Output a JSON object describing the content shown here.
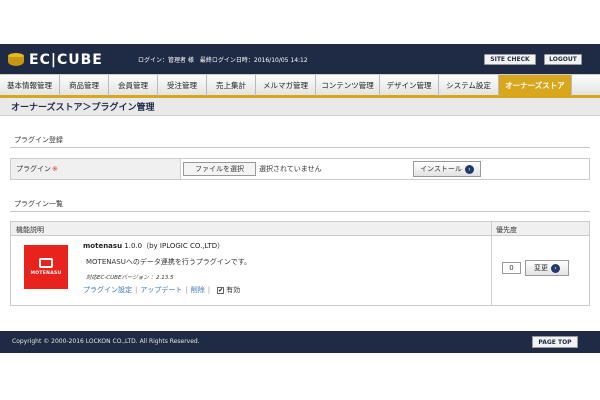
{
  "header": {
    "logo_text": "EC|CUBE",
    "login_info": "ログイン：管理者 様　最終ログイン日時：2016/10/05 14:12",
    "site_check": "SITE CHECK",
    "logout": "LOGOUT"
  },
  "nav": {
    "items": [
      {
        "label": "基本情報管理"
      },
      {
        "label": "商品管理"
      },
      {
        "label": "会員管理"
      },
      {
        "label": "受注管理"
      },
      {
        "label": "売上集計"
      },
      {
        "label": "メルマガ管理"
      },
      {
        "label": "コンテンツ管理"
      },
      {
        "label": "デザイン管理"
      },
      {
        "label": "システム設定"
      },
      {
        "label": "オーナーズストア"
      }
    ],
    "active_index": 9
  },
  "page_title": "オーナーズストア＞プラグイン管理",
  "register": {
    "section_title": "プラグイン登録",
    "field_label": "プラグイン",
    "required_mark": "※",
    "file_button": "ファイルを選択",
    "file_status": "選択されていません",
    "install_button": "インストール"
  },
  "list": {
    "section_title": "プラグイン一覧",
    "col_description": "機能説明",
    "col_priority": "優先度",
    "plugin": {
      "logo_text": "MOTENASU",
      "name": "motenasu",
      "version_info": "1.0.0（by IPLOGIC CO.,LTD）",
      "description": "MOTENASUへのデータ連携を行うプラグインです。",
      "compat": "対応EC-CUBEバージョン ：2.13.5",
      "link_settings": "プラグイン設定",
      "link_update": "アップデート",
      "link_delete": "削除",
      "enabled_label": "有効",
      "enabled": true,
      "priority": "0",
      "change_button": "変更"
    }
  },
  "footer": {
    "copyright": "Copyright © 2000-2016 LOCKON CO.,LTD. All Rights Reserved.",
    "page_top": "PAGE TOP"
  },
  "colors": {
    "header_bg": "#1f2b44",
    "nav_active": "#d8a71e",
    "plugin_logo": "#e8231d",
    "link": "#3a78b5"
  }
}
